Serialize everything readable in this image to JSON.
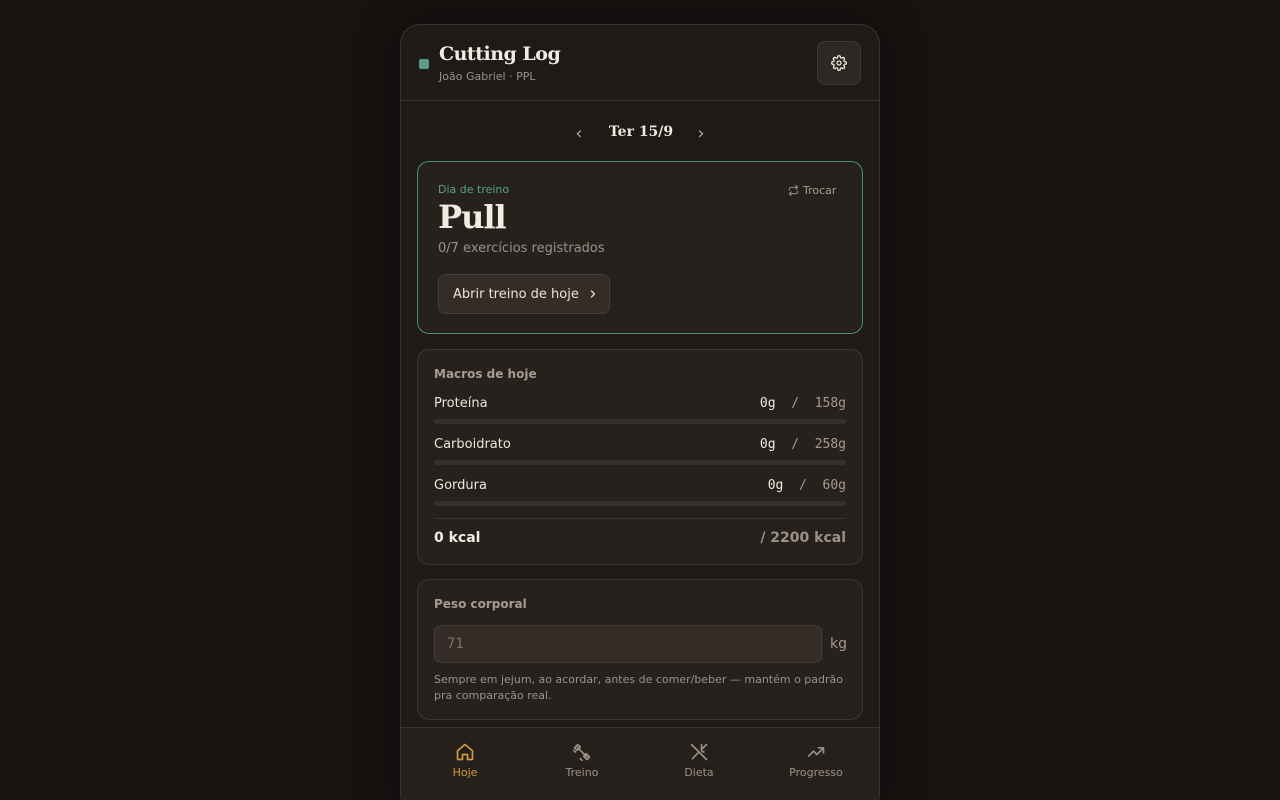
{
  "header": {
    "title": "Cutting Log",
    "subtitle": "João Gabriel · PPL",
    "status_color": "#5a9a8a"
  },
  "date_nav": {
    "prev_icon": "chevron-left-icon",
    "label": "Ter 15/9",
    "next_icon": "chevron-right-icon"
  },
  "workout": {
    "kicker": "Dia de treino",
    "swap_label": "Trocar",
    "name": "Pull",
    "progress_text": "0/7 exercícios registrados",
    "open_button_label": "Abrir treino de hoje"
  },
  "macros": {
    "title": "Macros de hoje",
    "items": [
      {
        "name": "Proteína",
        "current": "0g",
        "target": "158g",
        "fraction": 0
      },
      {
        "name": "Carboidrato",
        "current": "0g",
        "target": "258g",
        "fraction": 0
      },
      {
        "name": "Gordura",
        "current": "0g",
        "target": "60g",
        "fraction": 0
      }
    ],
    "kcal_current": "0 kcal",
    "kcal_target": "/ 2200 kcal"
  },
  "weight": {
    "title": "Peso corporal",
    "placeholder": "71",
    "value": "",
    "unit": "kg",
    "hint": "Sempre em jejum, ao acordar, antes de comer/beber — mantém o padrão pra comparação real."
  },
  "nav": {
    "items": [
      {
        "label": "Hoje",
        "icon": "home-icon",
        "active": true
      },
      {
        "label": "Treino",
        "icon": "dumbbell-icon",
        "active": false
      },
      {
        "label": "Dieta",
        "icon": "utensils-icon",
        "active": false
      },
      {
        "label": "Progresso",
        "icon": "trending-up-icon",
        "active": false
      }
    ]
  },
  "colors": {
    "accent": "#d49a3a",
    "teal": "#5a9a8a",
    "background": "#161311"
  }
}
